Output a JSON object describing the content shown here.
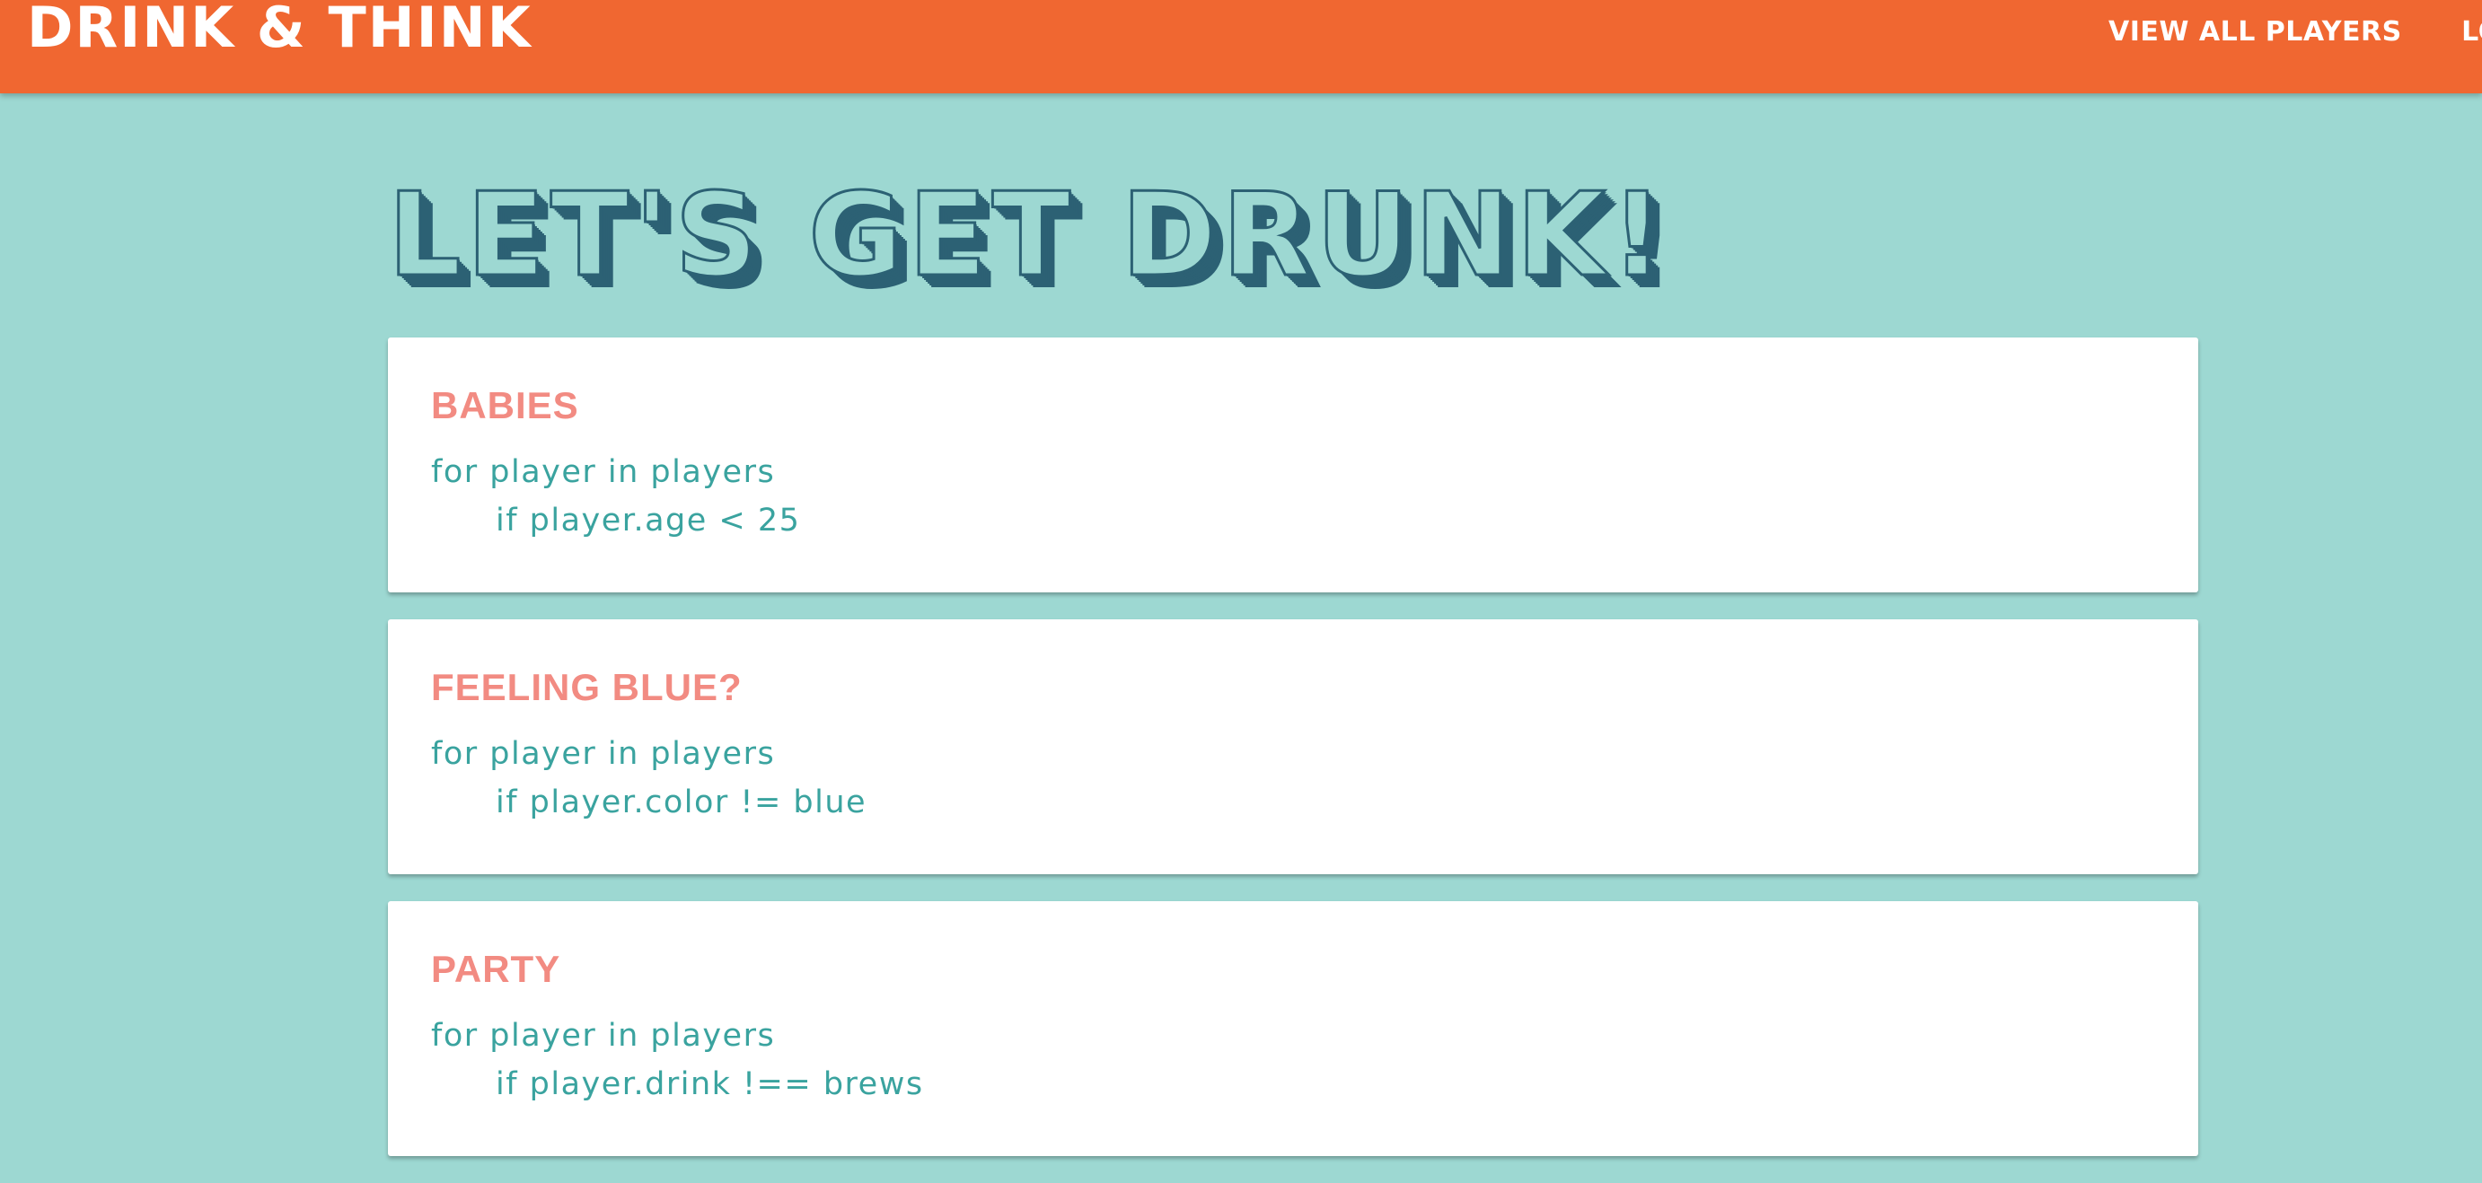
{
  "navbar": {
    "brand": "DRINK & THINK",
    "links": [
      "VIEW ALL PLAYERS",
      "LO"
    ]
  },
  "hero": {
    "title": "LET'S GET DRUNK!"
  },
  "rules": [
    {
      "title": "BABIES",
      "line1": "for player in players",
      "line2": "if player.age < 25"
    },
    {
      "title": "FEELING BLUE?",
      "line1": "for player in players",
      "line2": "if player.color != blue"
    },
    {
      "title": "PARTY",
      "line1": "for player in players",
      "line2": "if player.drink !== brews"
    }
  ],
  "colors": {
    "navbar": "#f06731",
    "background": "#9dd8d2",
    "hero_shadow": "#2c6174",
    "card_title": "#f28b82",
    "code_text": "#3aa39f"
  }
}
